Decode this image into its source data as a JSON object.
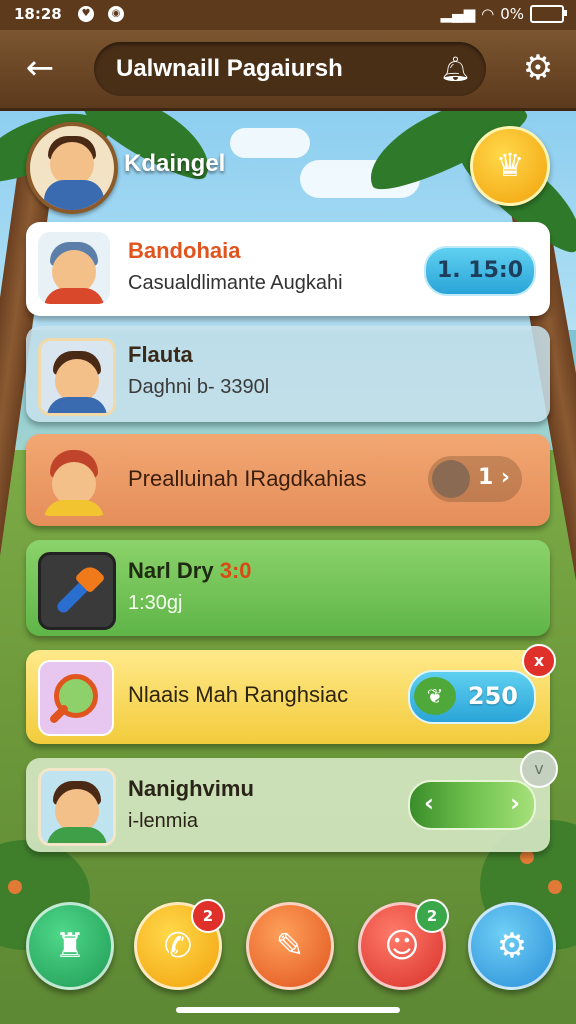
{
  "status_bar": {
    "time": "18:28",
    "battery": "0%"
  },
  "header": {
    "title": "Ualwnaill Pagaiursh"
  },
  "profile": {
    "name": "Kdaingel"
  },
  "cards": [
    {
      "title": "Bandohaia",
      "subtitle": "Casualdlimante Augkahi",
      "value": "1. 15:0"
    },
    {
      "title": "Flauta",
      "subtitle": "Daghni b- 3390l"
    },
    {
      "title": "Prealluinah IRagdkahias",
      "value": "1 ›"
    },
    {
      "title": "Narl Dry",
      "title_accent": "3:0",
      "subtitle": "1:30gj"
    },
    {
      "title": "Nlaais Mah Ranghsiac",
      "value": "250",
      "badge": "x"
    },
    {
      "title": "Nanighvimu",
      "subtitle": "i-lenmia",
      "left_arrow": "‹",
      "right_arrow": "›",
      "badge": "v"
    }
  ],
  "dock": {
    "badges": [
      "2",
      "2"
    ]
  },
  "icons": [
    "back-arrow-icon",
    "notification-bell-icon",
    "gear-icon",
    "crown-icon",
    "chef-hat-icon",
    "phone-icon",
    "feather-icon",
    "chat-monster-icon",
    "settings-gear-icon"
  ],
  "colors": {
    "header_brown": "#5c3a1d",
    "accent_orange": "#e0541e",
    "pill_blue": "#2aa4d8",
    "badge_red": "#e0302a"
  }
}
